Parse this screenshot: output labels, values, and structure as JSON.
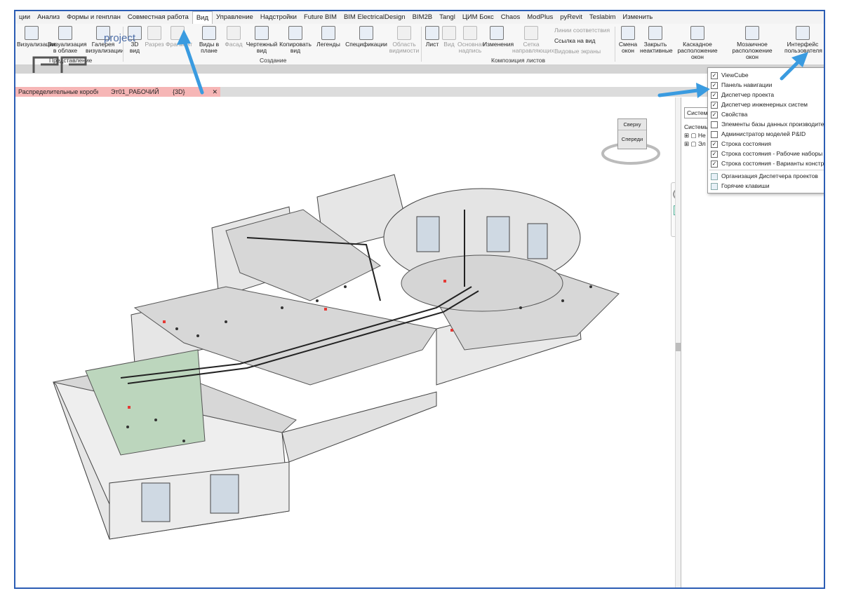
{
  "menu": {
    "items": [
      "ции",
      "Анализ",
      "Формы и генплан",
      "Совместная работа",
      "Вид",
      "Управление",
      "Надстройки",
      "Future BIM",
      "BIM ElectricalDesign",
      "BIM2B",
      "Tangl",
      "ЦИМ Бокс",
      "Chaos",
      "ModPlus",
      "pyRevit",
      "Teslabim",
      "Изменить"
    ],
    "active": "Вид"
  },
  "ribbon": {
    "buttons": {
      "viz": "Визуализация",
      "viz_cloud": "Визуализация в облаке",
      "gallery": "Галерея визуализации",
      "view3d": "3D вид",
      "section": "Разрез",
      "callout": "Фрагмент",
      "plans": "Виды в плане",
      "elevation": "Фасад",
      "drafting": "Чертежный вид",
      "duplicate": "Копировать вид",
      "legends": "Легенды",
      "schedules": "Спецификации",
      "scope": "Область видимости",
      "sheet": "Лист",
      "view": "Вид",
      "titleblock": "Основная надпись",
      "revisions": "Изменения",
      "grid": "Сетка направляющих",
      "matchline": "Линии соответствия",
      "viewref": "Ссылка на вид",
      "viewports": "Видовые экраны",
      "switch": "Смена окон",
      "close_inactive": "Закрыть неактивные",
      "cascade": "Каскадное расположение окон",
      "tile": "Мозаичное расположение окон",
      "ui": "Интерфейс пользователя"
    },
    "panels": {
      "presentation": "Представление",
      "create": "Создание",
      "sheet_composition": "Композиция листов"
    }
  },
  "watermark": "project",
  "tabs": {
    "t1": "Распределительные коробки",
    "t2": "Эт01_РАБОЧИЙ",
    "t3": "{3D}",
    "close": "✕"
  },
  "viewcube": {
    "top": "Сверху",
    "front": "Спереди"
  },
  "browser": {
    "combo": "Систем",
    "header": "Системы",
    "node1": "Не",
    "node2": "Эл"
  },
  "dropdown": {
    "items": [
      {
        "label": "ViewCube",
        "checked": true
      },
      {
        "label": "Панель навигации",
        "checked": true
      },
      {
        "label": "Диспетчер проекта",
        "checked": true
      },
      {
        "label": "Диспетчер инженерных систем",
        "checked": true
      },
      {
        "label": "Свойства",
        "checked": true
      },
      {
        "label": "Элементы базы данных производителя MEP",
        "checked": false
      },
      {
        "label": "Администратор моделей P&ID",
        "checked": false
      },
      {
        "label": "Строка состояния",
        "checked": true
      },
      {
        "label": "Строка состояния - Рабочие наборы",
        "checked": true
      },
      {
        "label": "Строка состояния - Варианты конструкции",
        "checked": true
      }
    ],
    "extra": [
      "Организация Диспетчера проектов",
      "Горячие клавиши"
    ]
  },
  "colors": {
    "accent_arrow": "#3a9be0",
    "frame": "#2b5db4",
    "pink_tab": "#f6b6b6"
  }
}
